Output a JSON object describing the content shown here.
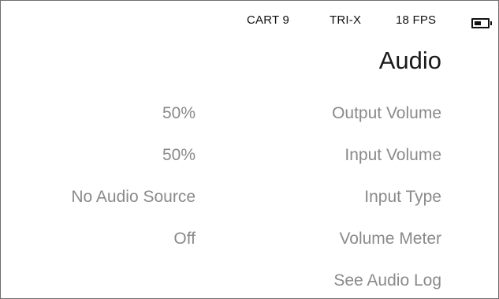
{
  "status_bar": {
    "cartridge": "CART 9",
    "film": "TRI-X",
    "fps": "18 FPS",
    "battery_level": 0.5
  },
  "title": "Audio",
  "settings": [
    {
      "label": "Output Volume",
      "value": "50%"
    },
    {
      "label": "Input Volume",
      "value": "50%"
    },
    {
      "label": "Input Type",
      "value": "No Audio Source"
    },
    {
      "label": "Volume Meter",
      "value": "Off"
    },
    {
      "label": "See Audio Log",
      "value": ""
    }
  ],
  "colors": {
    "text_primary": "#1a1a1a",
    "text_secondary": "#8a8a8a",
    "background": "#ffffff"
  }
}
